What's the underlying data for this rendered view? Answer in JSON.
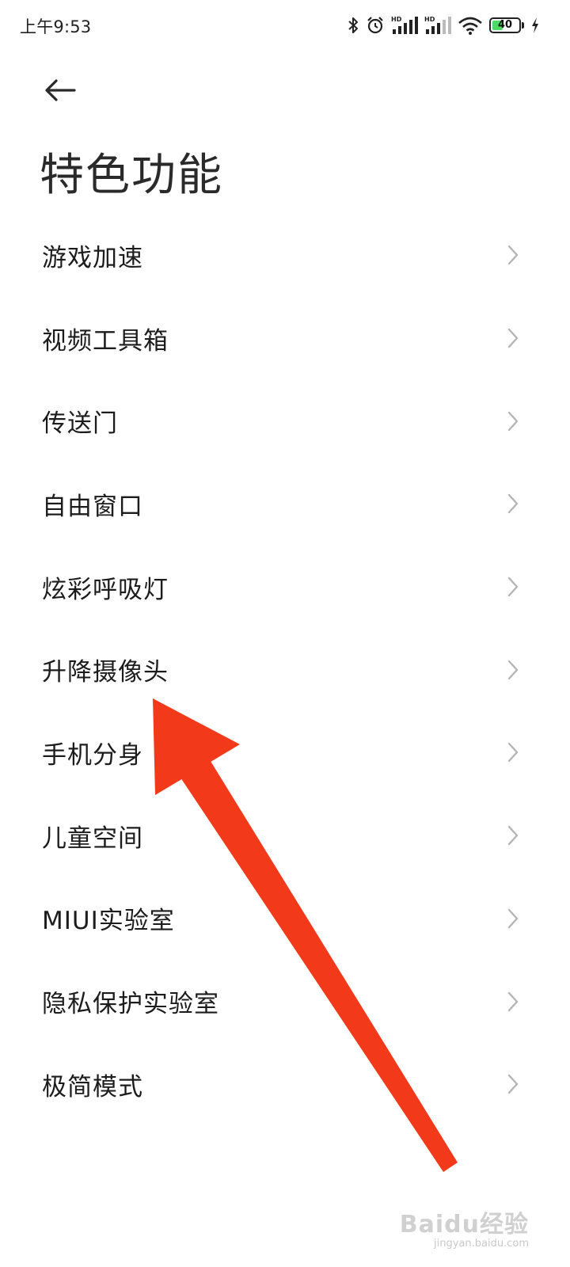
{
  "status_bar": {
    "time": "上午9:53",
    "icons": [
      "bluetooth-icon",
      "alarm-icon",
      "hd-signal-icon",
      "hd-signal-icon",
      "wifi-icon",
      "battery-icon",
      "charging-icon"
    ],
    "signal_label": "HD",
    "battery_level": "40",
    "battery_fraction": 0.4,
    "battery_color": "#4cd964"
  },
  "header": {
    "back_icon": "arrow-left-icon",
    "title": "特色功能"
  },
  "menu": {
    "items": [
      {
        "label": "游戏加速"
      },
      {
        "label": "视频工具箱"
      },
      {
        "label": "传送门"
      },
      {
        "label": "自由窗口"
      },
      {
        "label": "炫彩呼吸灯"
      },
      {
        "label": "升降摄像头"
      },
      {
        "label": "手机分身"
      },
      {
        "label": "儿童空间"
      },
      {
        "label": "MIUI实验室"
      },
      {
        "label": "隐私保护实验室"
      },
      {
        "label": "极简模式"
      }
    ],
    "chevron_icon": "chevron-right-icon"
  },
  "annotation": {
    "arrow_color": "#f23a1a",
    "points_to": "升降摄像头"
  },
  "watermark": {
    "logo": "Baidu经验",
    "url": "jingyan.baidu.com"
  }
}
